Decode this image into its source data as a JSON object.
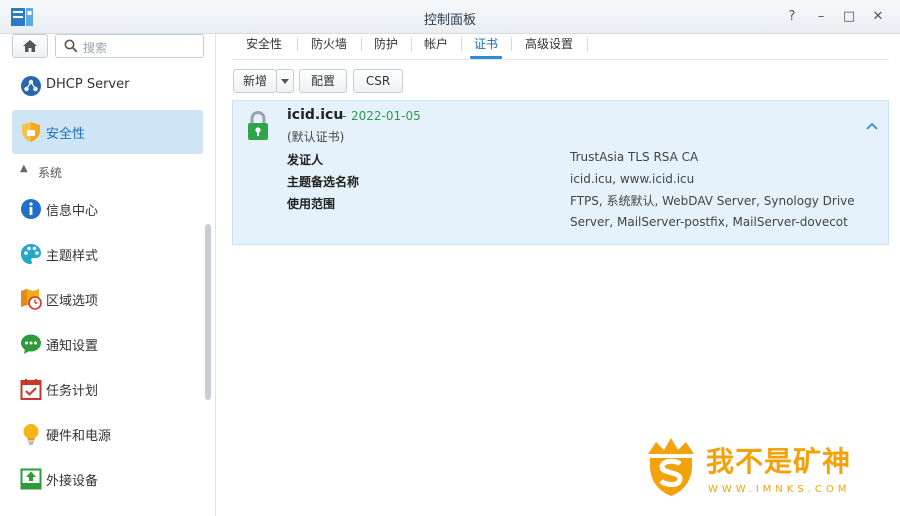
{
  "window": {
    "title": "控制面板",
    "buttons": {
      "help": "?",
      "minimize": "–",
      "maximize": "□",
      "close": "✕"
    }
  },
  "sidebar": {
    "search_placeholder": "搜索",
    "items_top": [
      {
        "label": "DHCP Server",
        "icon": "dhcp-server-icon"
      },
      {
        "label": "安全性",
        "icon": "security-shield-icon",
        "active": true
      }
    ],
    "group": {
      "label": "系统",
      "expanded": true
    },
    "items_system": [
      {
        "label": "信息中心",
        "icon": "info-center-icon"
      },
      {
        "label": "主题样式",
        "icon": "theme-palette-icon"
      },
      {
        "label": "区域选项",
        "icon": "regional-options-icon"
      },
      {
        "label": "通知设置",
        "icon": "notification-icon"
      },
      {
        "label": "任务计划",
        "icon": "task-scheduler-icon"
      },
      {
        "label": "硬件和电源",
        "icon": "hardware-power-icon"
      },
      {
        "label": "外接设备",
        "icon": "external-devices-icon"
      }
    ]
  },
  "tabs": [
    {
      "label": "安全性"
    },
    {
      "label": "防火墙"
    },
    {
      "label": "防护"
    },
    {
      "label": "帐户"
    },
    {
      "label": "证书",
      "active": true
    },
    {
      "label": "高级设置"
    }
  ],
  "toolbar": {
    "add_label": "新增",
    "configure_label": "配置",
    "csr_label": "CSR"
  },
  "certificate": {
    "name": "icid.icu",
    "separator": "-",
    "date": "2022-01-05",
    "default_note": "(默认证书)",
    "fields": [
      {
        "key": "发证人",
        "lines": [
          "TrustAsia TLS RSA CA"
        ]
      },
      {
        "key": "主题备选名称",
        "lines": [
          "icid.icu, www.icid.icu"
        ]
      },
      {
        "key": "使用范围",
        "lines": [
          "FTPS, 系统默认, WebDAV Server, Synology Drive",
          "Server, MailServer-postfix, MailServer-dovecot"
        ]
      }
    ]
  },
  "watermark": {
    "title": "我不是矿神",
    "url": "WWW.IMNKS.COM"
  },
  "colors": {
    "accent": "#2e8bd8",
    "active_bg": "#cfe5f5",
    "cert_bg": "#e5f2fb",
    "date_green": "#2e9b4a",
    "watermark_orange": "#f4a20b"
  }
}
